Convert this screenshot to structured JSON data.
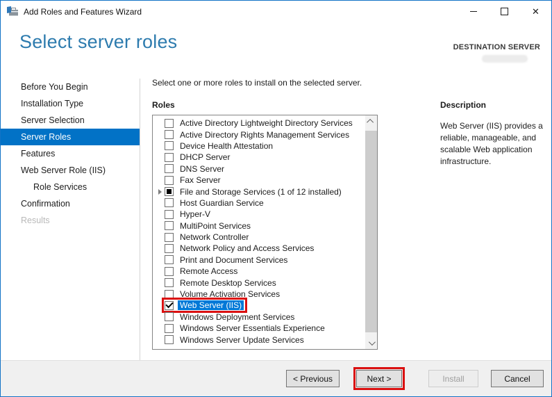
{
  "window": {
    "title": "Add Roles and Features Wizard"
  },
  "icons": {
    "close": "✕"
  },
  "header": {
    "title": "Select server roles",
    "destination_label": "DESTINATION SERVER"
  },
  "sidebar": {
    "items": [
      {
        "name": "before-you-begin",
        "label": "Before You Begin"
      },
      {
        "name": "installation-type",
        "label": "Installation Type"
      },
      {
        "name": "server-selection",
        "label": "Server Selection"
      },
      {
        "name": "server-roles",
        "label": "Server Roles",
        "selected": true
      },
      {
        "name": "features",
        "label": "Features"
      },
      {
        "name": "web-server-role-iis",
        "label": "Web Server Role (IIS)"
      },
      {
        "name": "role-services",
        "label": "Role Services",
        "indent": true
      },
      {
        "name": "confirmation",
        "label": "Confirmation"
      },
      {
        "name": "results",
        "label": "Results",
        "disabled": true
      }
    ]
  },
  "main": {
    "instruction": "Select one or more roles to install on the selected server.",
    "roles_header": "Roles",
    "roles": [
      {
        "label": "Active Directory Lightweight Directory Services"
      },
      {
        "label": "Active Directory Rights Management Services"
      },
      {
        "label": "Device Health Attestation"
      },
      {
        "label": "DHCP Server"
      },
      {
        "label": "DNS Server"
      },
      {
        "label": "Fax Server"
      },
      {
        "name": "file-and-storage-services",
        "label": "File and Storage Services (1 of 12 installed)",
        "partial": true,
        "expandable": true
      },
      {
        "label": "Host Guardian Service"
      },
      {
        "label": "Hyper-V"
      },
      {
        "label": "MultiPoint Services"
      },
      {
        "label": "Network Controller"
      },
      {
        "label": "Network Policy and Access Services"
      },
      {
        "label": "Print and Document Services"
      },
      {
        "label": "Remote Access"
      },
      {
        "label": "Remote Desktop Services"
      },
      {
        "label": "Volume Activation Services"
      },
      {
        "name": "web-server-iis",
        "label": "Web Server (IIS)",
        "checked": true,
        "selected": true,
        "annotated": true
      },
      {
        "label": "Windows Deployment Services"
      },
      {
        "label": "Windows Server Essentials Experience"
      },
      {
        "label": "Windows Server Update Services"
      }
    ],
    "description": {
      "header": "Description",
      "text": "Web Server (IIS) provides a reliable, manageable, and scalable Web application infrastructure."
    }
  },
  "footer": {
    "buttons": [
      {
        "name": "previous",
        "label": "< Previous"
      },
      {
        "name": "next",
        "label": "Next >",
        "annotated": true
      },
      {
        "name": "install",
        "label": "Install",
        "disabled": true
      },
      {
        "name": "cancel",
        "label": "Cancel"
      }
    ]
  },
  "colors": {
    "window_border": "#1273c6",
    "sidebar_selected": "#0272c6",
    "list_selection": "#0078d7",
    "annotation_red": "#da1010",
    "title_blue": "#2d7bae",
    "footer_bg": "#f0f0f0"
  }
}
